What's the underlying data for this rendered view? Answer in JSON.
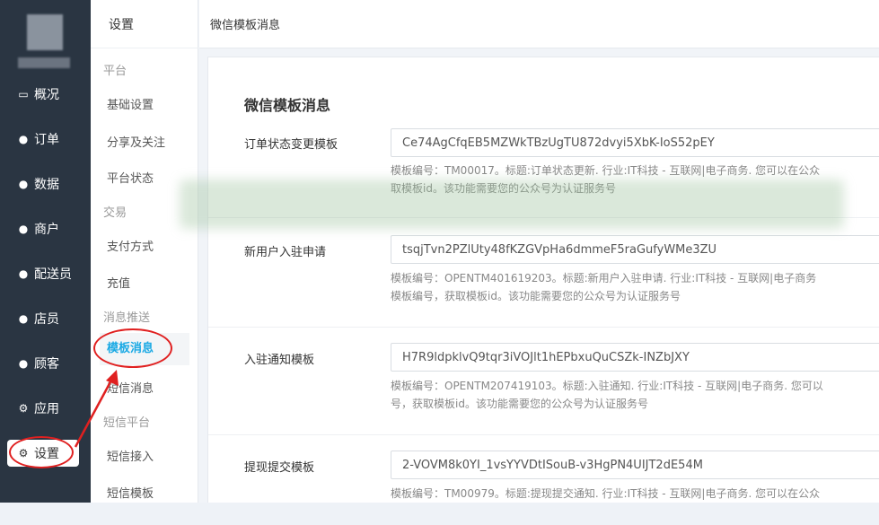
{
  "nav": {
    "items": [
      {
        "icon": "monitor-icon",
        "glyph": "🖵",
        "label": "概况"
      },
      {
        "icon": "user-icon",
        "glyph": "👤",
        "label": "订单"
      },
      {
        "icon": "user-icon",
        "glyph": "👤",
        "label": "数据"
      },
      {
        "icon": "user-icon",
        "glyph": "👤",
        "label": "商户"
      },
      {
        "icon": "user-icon",
        "glyph": "👤",
        "label": "配送员"
      },
      {
        "icon": "user-icon",
        "glyph": "👤",
        "label": "店员"
      },
      {
        "icon": "user-icon",
        "glyph": "👤",
        "label": "顾客"
      },
      {
        "icon": "gear-icon",
        "glyph": "⚙",
        "label": "应用"
      },
      {
        "icon": "gear-icon",
        "glyph": "⚙",
        "label": "设置"
      }
    ],
    "active_index": 8
  },
  "submenu": {
    "title": "设置",
    "groups": [
      {
        "label": "平台"
      },
      {
        "label": "交易"
      },
      {
        "label": "消息推送"
      },
      {
        "label": "短信平台"
      }
    ],
    "items": [
      {
        "label": "基础设置"
      },
      {
        "label": "分享及关注"
      },
      {
        "label": "平台状态"
      },
      {
        "label": "支付方式"
      },
      {
        "label": "充值"
      },
      {
        "label": "模板消息"
      },
      {
        "label": "短信消息"
      },
      {
        "label": "短信接入"
      },
      {
        "label": "短信模板"
      }
    ],
    "active_item": "模板消息"
  },
  "header": {
    "title": "微信模板消息"
  },
  "panel": {
    "title": "微信模板消息",
    "rows": [
      {
        "label": "订单状态变更模板",
        "value": "Ce74AgCfqEB5MZWkTBzUgTU872dvyi5XbK-IoS52pEY",
        "hint1": "模板编号：TM00017。标题:订单状态更新. 行业:IT科技 - 互联网|电子商务. 您可以在公众",
        "hint2": "取模板id。该功能需要您的公众号为认证服务号"
      },
      {
        "label": "新用户入驻申请",
        "value": "tsqjTvn2PZlUty48fKZGVpHa6dmmeF5raGufyWMe3ZU",
        "hint1": "模板编号：OPENTM401619203。标题:新用户入驻申请. 行业:IT科技 - 互联网|电子商务",
        "hint2": "模板编号，获取模板id。该功能需要您的公众号为认证服务号"
      },
      {
        "label": "入驻通知模板",
        "value": "H7R9ldpklvQ9tqr3iVOJlt1hEPbxuQuCSZk-INZbJXY",
        "hint1": "模板编号：OPENTM207419103。标题:入驻通知. 行业:IT科技 - 互联网|电子商务. 您可以",
        "hint2": "号，获取模板id。该功能需要您的公众号为认证服务号"
      },
      {
        "label": "提现提交模板",
        "value": "2-VOVM8k0YI_1vsYYVDtISouB-v3HgPN4UIJT2dE54M",
        "hint1": "模板编号：TM00979。标题:提现提交通知. 行业:IT科技 - 互联网|电子商务. 您可以在公众",
        "hint2": ""
      }
    ]
  },
  "colors": {
    "nav_bg": "#2a3542",
    "accent": "#1aa9e4",
    "annotation": "#e02020"
  }
}
